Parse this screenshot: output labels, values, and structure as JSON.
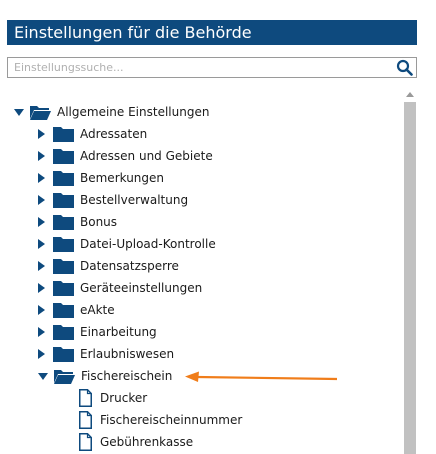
{
  "panel": {
    "title": "Einstellungen für die Behörde"
  },
  "search": {
    "placeholder": "Einstellungssuche..."
  },
  "tree": {
    "root": {
      "label": "Allgemeine Einstellungen",
      "expanded": true
    },
    "items": [
      {
        "label": "Adressaten"
      },
      {
        "label": "Adressen und Gebiete"
      },
      {
        "label": "Bemerkungen"
      },
      {
        "label": "Bestellverwaltung"
      },
      {
        "label": "Bonus"
      },
      {
        "label": "Datei-Upload-Kontrolle"
      },
      {
        "label": "Datensatzsperre"
      },
      {
        "label": "Geräteeinstellungen"
      },
      {
        "label": "eAkte"
      },
      {
        "label": "Einarbeitung"
      },
      {
        "label": "Erlaubniswesen"
      },
      {
        "label": "Fischereischein",
        "expanded": true
      }
    ],
    "children": [
      {
        "label": "Drucker"
      },
      {
        "label": "Fischereischeinnummer"
      },
      {
        "label": "Gebührenkasse"
      }
    ]
  },
  "colors": {
    "titlebar": "#0e4a7e",
    "folder": "#0e4a7e",
    "annotation_arrow": "#f07d1a",
    "scrollbar_thumb": "#c1c1c1"
  },
  "icons": {
    "search": "search-icon",
    "folder": "folder-icon",
    "folder_open": "folder-open-icon",
    "document": "document-icon"
  }
}
